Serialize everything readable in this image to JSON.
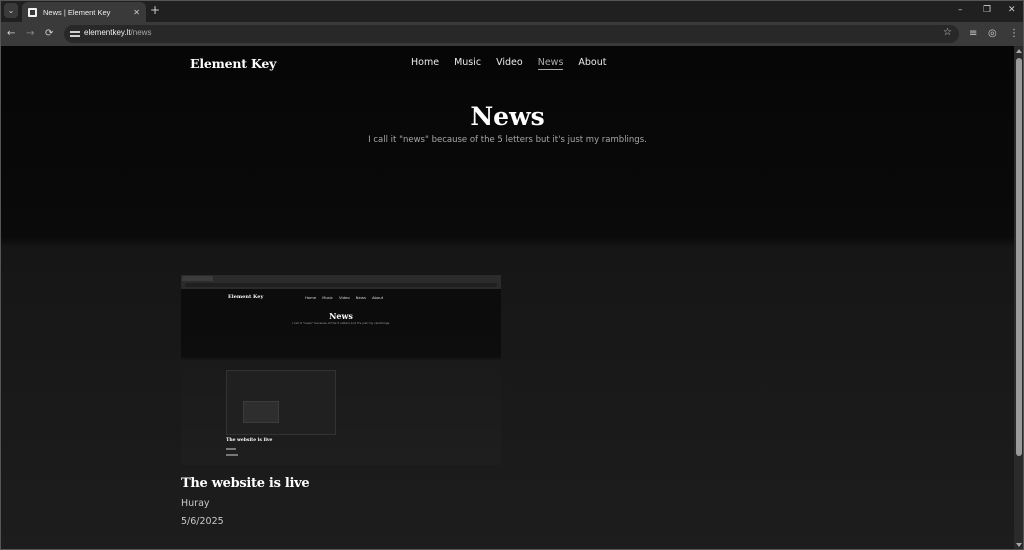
{
  "browser": {
    "tab_menu_icon": "chevron-down-icon",
    "tab": {
      "title": "News | Element Key",
      "close": "✕"
    },
    "new_tab": "+",
    "window_controls": {
      "minimize": "–",
      "restore": "❐",
      "close": "✕"
    },
    "nav": {
      "back": "←",
      "forward": "→",
      "reload": "⟳"
    },
    "url": {
      "host": "elementkey.lt",
      "path": "/news"
    },
    "bookmark_star": "☆",
    "toolbar_icons": [
      "media-controls-icon",
      "profile-icon",
      "menu-icon"
    ],
    "toolbar_glyphs": {
      "media": "≡",
      "profile": "◎",
      "menu": "⋮"
    }
  },
  "site": {
    "logo": "Element Key",
    "nav": [
      {
        "label": "Home",
        "active": false
      },
      {
        "label": "Music",
        "active": false
      },
      {
        "label": "Video",
        "active": false
      },
      {
        "label": "News",
        "active": true
      },
      {
        "label": "About",
        "active": false
      }
    ]
  },
  "hero": {
    "title": "News",
    "subtitle": "I call it \"news\" because of the 5 letters but it's just my ramblings."
  },
  "posts": [
    {
      "title": "The website is live",
      "excerpt": "Huray",
      "date": "5/6/2025",
      "thumbnail": {
        "logo": "Element Key",
        "nav": [
          "Home",
          "Music",
          "Video",
          "News",
          "About"
        ],
        "title": "News",
        "subtitle": "I call it \"news\" because of the 5 letters but it's just my ramblings.",
        "post_title": "The website is live"
      }
    }
  ],
  "colors": {
    "background": "#1e1e1e",
    "page_top": "#060606",
    "text": "#ffffff",
    "muted": "#a7a7a7",
    "active_nav": "#a9a9a9"
  }
}
